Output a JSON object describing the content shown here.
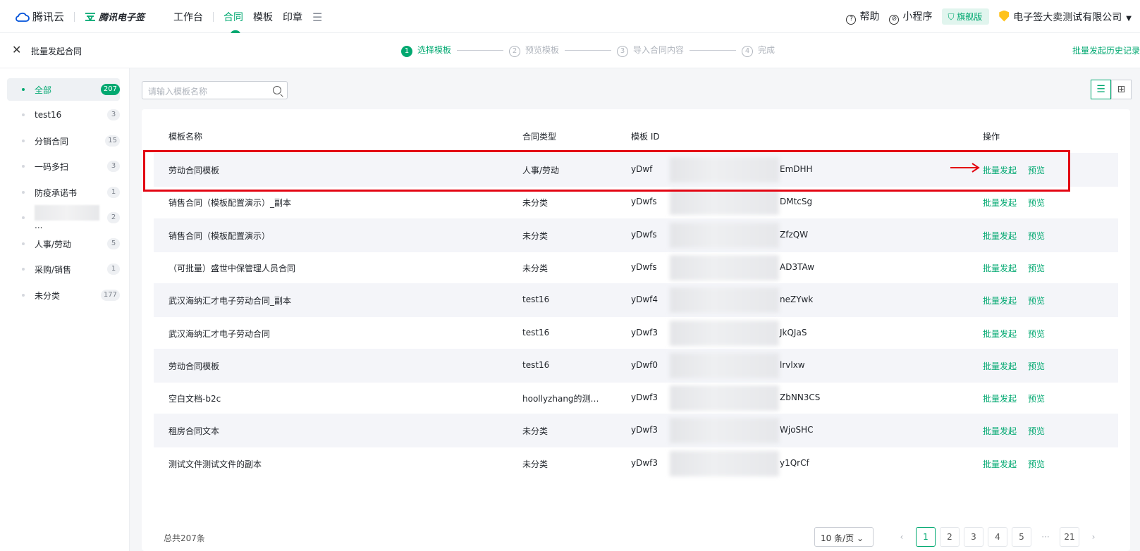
{
  "topbar": {
    "brand_cloud": "腾讯云",
    "brand_esign": "腾讯电子签",
    "nav": [
      "工作台",
      "合同",
      "模板",
      "印章"
    ],
    "help": "帮助",
    "miniprogram": "小程序",
    "edition": "旗舰版",
    "company": "电子签大卖测试有限公司"
  },
  "stepbar": {
    "title": "批量发起合同",
    "steps": [
      "选择模板",
      "预览模板",
      "导入合同内容",
      "完成"
    ],
    "step_nums": [
      "1",
      "2",
      "3",
      "4"
    ],
    "history": "批量发起历史记录"
  },
  "sidebar": {
    "items": [
      {
        "label": "全部",
        "count": "207"
      },
      {
        "label": "test16",
        "count": "3"
      },
      {
        "label": "分销合同",
        "count": "15"
      },
      {
        "label": "一码多扫",
        "count": "3"
      },
      {
        "label": "防疫承诺书",
        "count": "1"
      },
      {
        "label": "...",
        "count": "2"
      },
      {
        "label": "人事/劳动",
        "count": "5"
      },
      {
        "label": "采购/销售",
        "count": "1"
      },
      {
        "label": "未分类",
        "count": "177"
      }
    ]
  },
  "search": {
    "placeholder": "请输入模板名称"
  },
  "table": {
    "headers": {
      "name": "模板名称",
      "type": "合同类型",
      "id": "模板 ID",
      "op": "操作"
    },
    "action_batch": "批量发起",
    "action_preview": "预览",
    "rows": [
      {
        "name": "劳动合同模板",
        "type": "人事/劳动",
        "id_head": "yDwf",
        "id_tail": "EmDHH"
      },
      {
        "name": "销售合同（模板配置演示）_副本",
        "type": "未分类",
        "id_head": "yDwfs",
        "id_tail": "DMtcSg"
      },
      {
        "name": "销售合同（模板配置演示）",
        "type": "未分类",
        "id_head": "yDwfs",
        "id_tail": "ZfzQW"
      },
      {
        "name": "（可批量）盛世中保管理人员合同",
        "type": "未分类",
        "id_head": "yDwfs",
        "id_tail": "AD3TAw"
      },
      {
        "name": "武汉海纳汇才电子劳动合同_副本",
        "type": "test16",
        "id_head": "yDwf4",
        "id_tail": "neZYwk"
      },
      {
        "name": "武汉海纳汇才电子劳动合同",
        "type": "test16",
        "id_head": "yDwf3",
        "id_tail": "JkQJaS"
      },
      {
        "name": "劳动合同模板",
        "type": "test16",
        "id_head": "yDwf0",
        "id_tail": "lrvlxw"
      },
      {
        "name": "空白文档-b2c",
        "type": "hoollyzhang的测…",
        "id_head": "yDwf3",
        "id_tail": "ZbNN3CS"
      },
      {
        "name": "租房合同文本",
        "type": "未分类",
        "id_head": "yDwf3",
        "id_tail": "WjoSHC"
      },
      {
        "name": "测试文件测试文件的副本",
        "type": "未分类",
        "id_head": "yDwf3",
        "id_tail": "y1QrCf"
      }
    ]
  },
  "footer": {
    "total": "总共207条",
    "page_size": "10 条/页",
    "pages": [
      "1",
      "2",
      "3",
      "4",
      "5",
      "···",
      "21"
    ],
    "prev": "‹",
    "next": "›"
  },
  "colors": {
    "accent": "#00a870",
    "highlight": "#e30613"
  }
}
